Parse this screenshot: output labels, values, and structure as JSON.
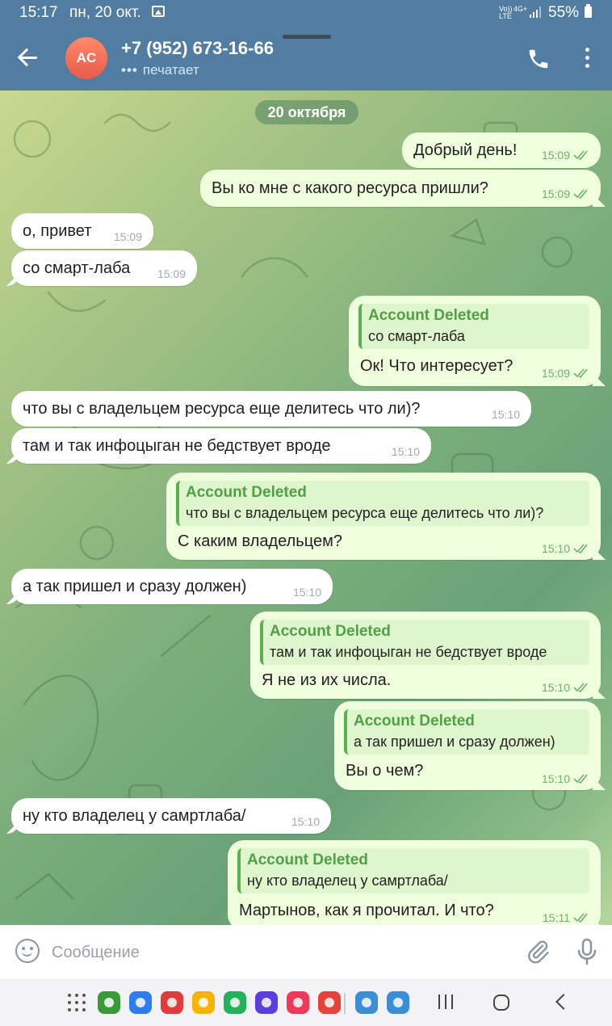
{
  "status_bar": {
    "time": "15:17",
    "date": "пн, 20 окт.",
    "network_1": "Vo)) LTE",
    "network_2": "4G+",
    "battery": "55%"
  },
  "header": {
    "avatar_initials": "AC",
    "avatar_colors": [
      "#ff8a6a",
      "#ea5a48"
    ],
    "title": "+7 (952) 673-16-66",
    "status_text": "печатает",
    "status_dots": "•••",
    "accent": "#517da2"
  },
  "chat": {
    "date_chip": "20 октября",
    "messages": [
      {
        "dir": "out",
        "text": "Добрый день!",
        "time": "15:09",
        "read": true
      },
      {
        "dir": "out",
        "text": "Вы ко мне с какого ресурса пришли?",
        "time": "15:09",
        "read": true
      },
      {
        "dir": "in",
        "text": "о, привет",
        "time": "15:09"
      },
      {
        "dir": "in",
        "text": "со смарт-лаба",
        "time": "15:09"
      },
      {
        "dir": "out",
        "reply_name": "Account Deleted",
        "reply_text": "со смарт-лаба",
        "text": "Ок! Что интересует?",
        "time": "15:09",
        "read": true
      },
      {
        "dir": "in",
        "text": "что вы с владельцем ресурса еще делитесь что ли)?",
        "time": "15:10"
      },
      {
        "dir": "in",
        "text": "там и так инфоцыган не бедствует вроде",
        "time": "15:10"
      },
      {
        "dir": "out",
        "reply_name": "Account Deleted",
        "reply_text": "что вы с владельцем ресурса еще делитесь что ли)?",
        "text": "С каким владельцем?",
        "time": "15:10",
        "read": true
      },
      {
        "dir": "in",
        "text": "а так пришел и сразу должен)",
        "time": "15:10"
      },
      {
        "dir": "out",
        "reply_name": "Account Deleted",
        "reply_text": "там и так инфоцыган не бедствует вроде",
        "text": "Я не из их числа.",
        "time": "15:10",
        "read": true
      },
      {
        "dir": "out",
        "reply_name": "Account Deleted",
        "reply_text": "а так пришел и сразу должен)",
        "text": "Вы о чем?",
        "time": "15:10",
        "read": true
      },
      {
        "dir": "in",
        "text": "ну кто владелец у самртлаба/",
        "time": "15:10"
      },
      {
        "dir": "out",
        "reply_name": "Account Deleted",
        "reply_text": "ну кто владелец у самртлаба/",
        "text": "Мартынов, как я прочитал. И что?",
        "time": "15:11",
        "read": true
      }
    ]
  },
  "composer": {
    "placeholder": "Сообщение"
  },
  "nav_bar": {
    "apps": [
      "calculator-icon",
      "messages-icon",
      "flipboard-icon",
      "files-icon",
      "phone-icon",
      "browser-icon",
      "camera-icon",
      "voice-recorder-icon",
      "pinwheel-app-1-icon",
      "pinwheel-app-2-icon"
    ],
    "app_colors": [
      "#3a9a3a",
      "#2d7cf0",
      "#e23b3b",
      "#f6b400",
      "#23b15a",
      "#5a3fe0",
      "#f0385a",
      "#e8413a",
      "#3a8ed8",
      "#3a8ed8"
    ]
  }
}
